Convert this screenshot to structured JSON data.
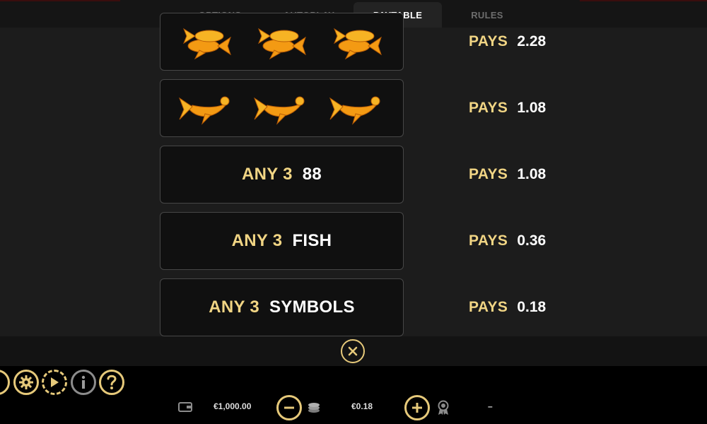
{
  "tabs": [
    {
      "label": "OPTIONS",
      "active": false
    },
    {
      "label": "AUTOPLAY",
      "active": false
    },
    {
      "label": "PAYTABLE",
      "active": true
    },
    {
      "label": "RULES",
      "active": false
    }
  ],
  "paytable": [
    {
      "symbols": "pair-koi-icon",
      "pays_label": "PAYS",
      "pays_value": "2.28"
    },
    {
      "symbols": "koi-fish-icon",
      "pays_label": "PAYS",
      "pays_value": "1.08"
    },
    {
      "any_label": "ANY 3",
      "item": "88",
      "pays_label": "PAYS",
      "pays_value": "1.08"
    },
    {
      "any_label": "ANY 3",
      "item": "FISH",
      "pays_label": "PAYS",
      "pays_value": "0.36"
    },
    {
      "any_label": "ANY 3",
      "item": "SYMBOLS",
      "pays_label": "PAYS",
      "pays_value": "0.18"
    }
  ],
  "bottom": {
    "balance": "€1,000.00",
    "bet": "€0.18",
    "win": "–"
  },
  "colors": {
    "gold": "#f1d584",
    "accent_ring": "#e6c97a",
    "fish_orange": "#f39a13"
  }
}
